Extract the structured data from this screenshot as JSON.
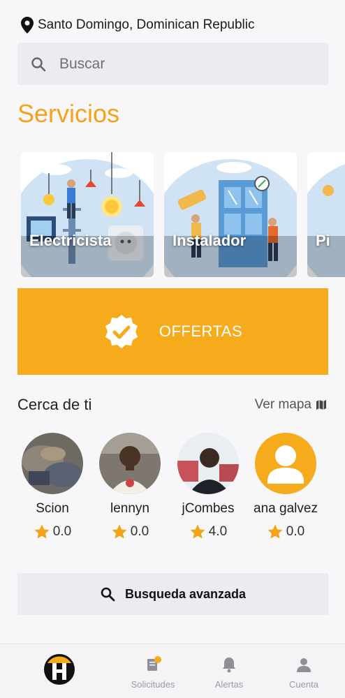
{
  "location": {
    "text": "Santo Domingo, Dominican Republic",
    "icon": "map-pin-icon"
  },
  "search": {
    "placeholder": "Buscar",
    "icon": "search-icon"
  },
  "services": {
    "title": "Servicios",
    "cards": [
      {
        "label": "Electricista"
      },
      {
        "label": "Instalador"
      },
      {
        "label": "Pi"
      }
    ]
  },
  "offers": {
    "label": "OFFERTAS",
    "icon": "check-badge-icon",
    "color": "#f5ab1b"
  },
  "nearby": {
    "title": "Cerca de ti",
    "map_link": "Ver mapa",
    "people": [
      {
        "name": "Scion",
        "rating": "0.0"
      },
      {
        "name": "lennyn",
        "rating": "0.0"
      },
      {
        "name": "jCombes",
        "rating": "4.0"
      },
      {
        "name": "ana galvez",
        "rating": "0.0"
      }
    ]
  },
  "advanced_search": {
    "label": "Busqueda avanzada",
    "icon": "search-icon"
  },
  "bottom_nav": {
    "items": [
      {
        "label": "",
        "icon": "app-logo-icon"
      },
      {
        "label": "Solicitudes",
        "icon": "requests-icon"
      },
      {
        "label": "Alertas",
        "icon": "bell-icon"
      },
      {
        "label": "Cuenta",
        "icon": "user-icon"
      }
    ]
  },
  "colors": {
    "accent": "#f5a21b",
    "star": "#f5a21b",
    "search_bg": "#ebebf0"
  }
}
